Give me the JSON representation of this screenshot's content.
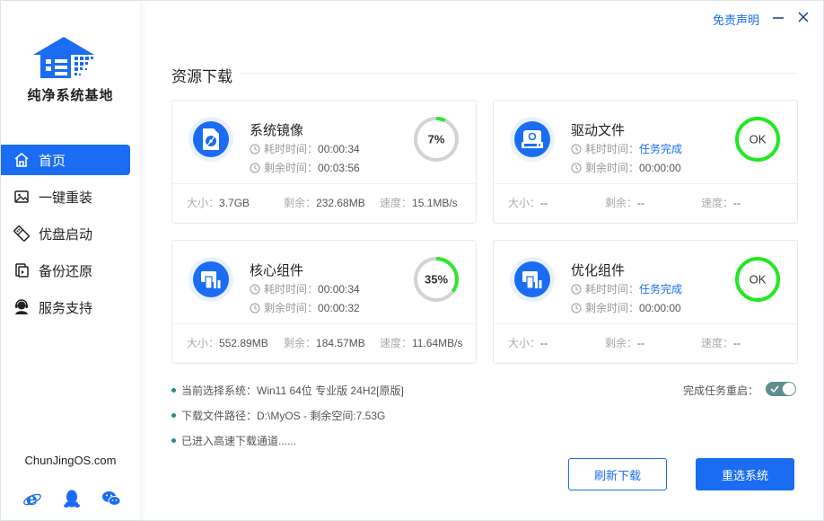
{
  "app": {
    "brand_name": "纯净系统基地",
    "site": "ChunJingOS.com",
    "accent": "#1a6df3"
  },
  "topbar": {
    "disclaimer": "免责声明"
  },
  "nav": [
    {
      "label": "首页",
      "icon": "home-icon",
      "active": true
    },
    {
      "label": "一键重装",
      "icon": "image-icon",
      "active": false
    },
    {
      "label": "优盘启动",
      "icon": "usb-drive-icon",
      "active": false
    },
    {
      "label": "备份还原",
      "icon": "backup-icon",
      "active": false
    },
    {
      "label": "服务支持",
      "icon": "support-agent-icon",
      "active": false
    }
  ],
  "social": [
    "ie-icon",
    "qq-icon",
    "wechat-icon"
  ],
  "section": {
    "title": "资源下载"
  },
  "labels": {
    "elapsed": "耗时时间：",
    "remaining": "剩余时间：",
    "size": "大小：",
    "left": "剩余：",
    "speed": "速度："
  },
  "cards": [
    {
      "title": "系统镜像",
      "icon": "disc-image-icon",
      "elapsed": "00:00:34",
      "remaining": "00:03:56",
      "status_text": "7%",
      "progress": 0.07,
      "ok": false,
      "size": "3.7GB",
      "left": "232.68MB",
      "speed": "15.1MB/s"
    },
    {
      "title": "驱动文件",
      "icon": "hard-drive-icon",
      "elapsed": "任务完成",
      "remaining": "00:00:00",
      "status_text": "OK",
      "progress": 1.0,
      "ok": true,
      "size": "--",
      "left": "--",
      "speed": "--"
    },
    {
      "title": "核心组件",
      "icon": "component-icon",
      "elapsed": "00:00:34",
      "remaining": "00:00:32",
      "status_text": "35%",
      "progress": 0.35,
      "ok": false,
      "size": "552.89MB",
      "left": "184.57MB",
      "speed": "11.64MB/s"
    },
    {
      "title": "优化组件",
      "icon": "component-icon",
      "elapsed": "任务完成",
      "remaining": "00:00:00",
      "status_text": "OK",
      "progress": 1.0,
      "ok": true,
      "size": "--",
      "left": "--",
      "speed": "--"
    }
  ],
  "info": {
    "current_system": "当前选择系统：Win11 64位 专业版 24H2[原版]",
    "download_path": "下载文件路径：D:\\MyOS - 剩余空间:7.53G",
    "channel": "已进入高速下载通道......"
  },
  "reboot": {
    "label": "完成任务重启：",
    "enabled": true
  },
  "buttons": {
    "refresh": "刷新下载",
    "reselect": "重选系统"
  },
  "colors": {
    "progress": "#2ee62e",
    "track": "#d3d3d3",
    "ok_ring": "#22e822"
  }
}
